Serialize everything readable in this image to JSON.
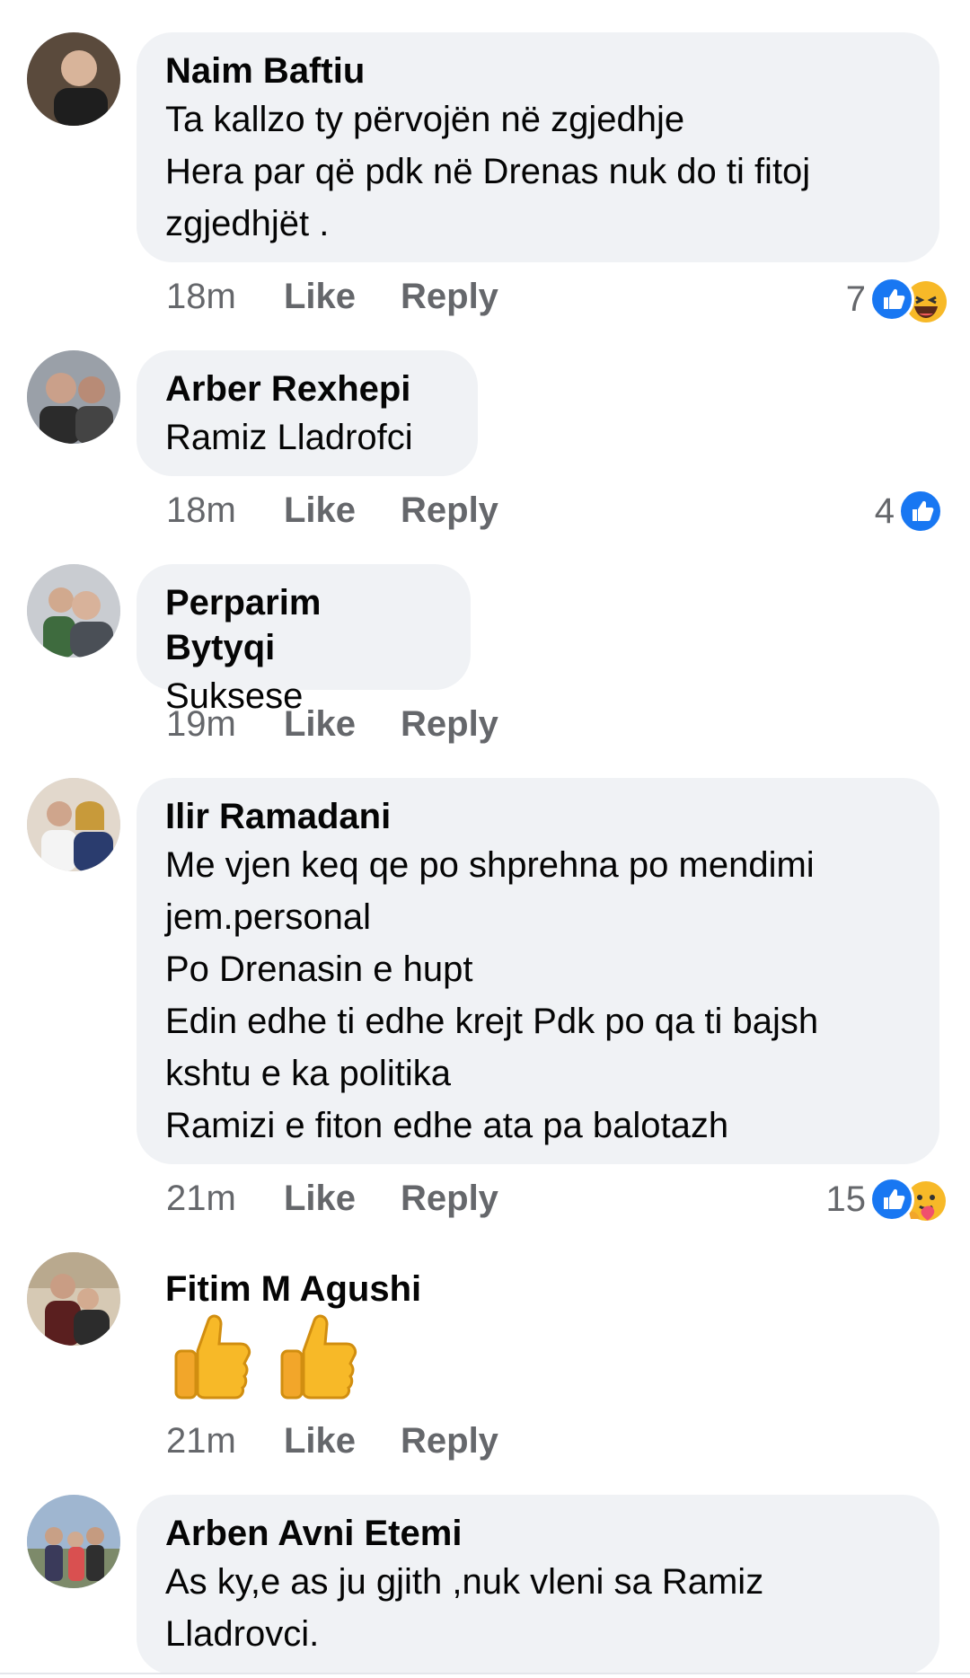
{
  "comments": [
    {
      "name": "Naim Baftiu",
      "text": "Ta kallzo ty përvojën në zgjedhje\nHera par që pdk në Drenas nuk do ti fitoj zgjedhjët .",
      "time": "18m",
      "like": "Like",
      "reply": "Reply",
      "reaction_count": "7",
      "reactions": [
        "like-icon",
        "haha-icon"
      ]
    },
    {
      "name": "Arber Rexhepi",
      "text": "Ramiz Lladrofci",
      "time": "18m",
      "like": "Like",
      "reply": "Reply",
      "reaction_count": "4",
      "reactions": [
        "like-icon"
      ]
    },
    {
      "name": "Perparim Bytyqi",
      "text": "Suksese",
      "time": "19m",
      "like": "Like",
      "reply": "Reply"
    },
    {
      "name": "Ilir Ramadani",
      "text": "Me vjen keq qe po shprehna po mendimi jem.personal\nPo Drenasin e hupt\nEdin edhe ti edhe krejt Pdk  po  qa  ti bajsh kshtu e ka politika\nRamizi e fiton edhe ata pa balotazh",
      "time": "21m",
      "like": "Like",
      "reply": "Reply",
      "reaction_count": "15",
      "reactions": [
        "like-icon",
        "care-icon"
      ]
    },
    {
      "name": "Fitim M Agushi",
      "text": "",
      "emoji": [
        "thumbs-up-emoji",
        "thumbs-up-emoji"
      ],
      "time": "21m",
      "like": "Like",
      "reply": "Reply"
    },
    {
      "name": "Arben Avni Etemi",
      "text": "As ky,e as ju gjith ,nuk vleni sa Ramiz Lladrovci."
    }
  ],
  "colors": {
    "bubble": "#f0f2f5",
    "meta_text": "#65676b",
    "like_blue": "#1877f2",
    "emoji_yellow": "#f7b928"
  }
}
